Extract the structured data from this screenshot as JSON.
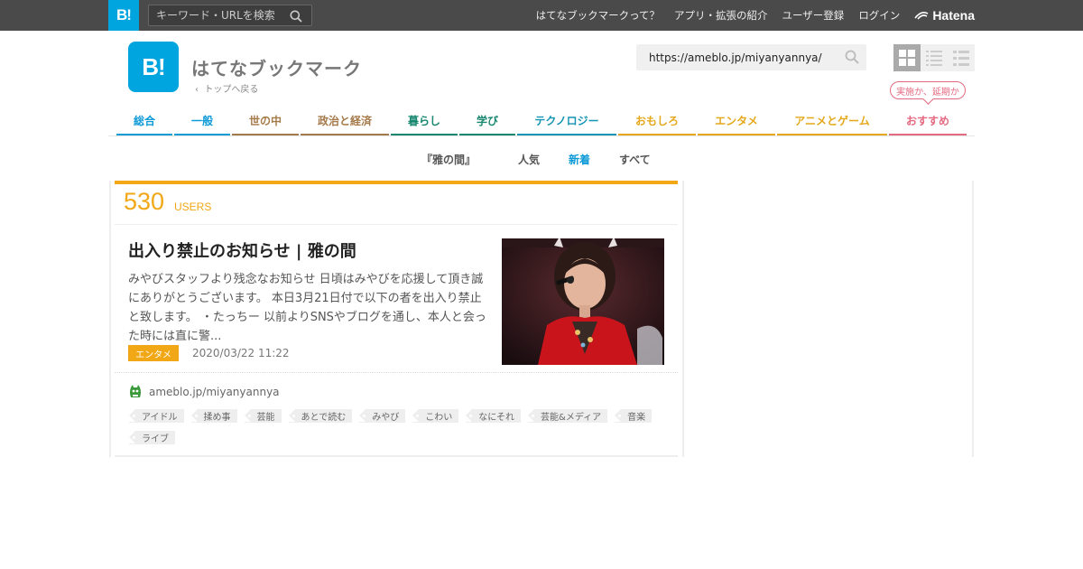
{
  "globalbar": {
    "logo": "B!",
    "search_placeholder": "キーワード・URLを検索",
    "links": [
      "はてなブックマークって？",
      "アプリ・拡張の紹介",
      "ユーザー登録",
      "ログイン"
    ],
    "hatena": "Hatena"
  },
  "header": {
    "logo": "B!",
    "brand": "はてなブックマーク",
    "back": "トップへ戻る",
    "url_value": "https://ameblo.jp/miyanyannya/",
    "balloon": "実施か、延期か"
  },
  "categories": [
    {
      "label": "総合",
      "color": "#0e9ad6"
    },
    {
      "label": "一般",
      "color": "#0e9ad6"
    },
    {
      "label": "世の中",
      "color": "#a57a4a"
    },
    {
      "label": "政治と経済",
      "color": "#a57a4a"
    },
    {
      "label": "暮らし",
      "color": "#17876f"
    },
    {
      "label": "学び",
      "color": "#17876f"
    },
    {
      "label": "テクノロジー",
      "color": "#1795b5"
    },
    {
      "label": "おもしろ",
      "color": "#e5a81c"
    },
    {
      "label": "エンタメ",
      "color": "#e5a81c"
    },
    {
      "label": "アニメとゲーム",
      "color": "#e5a81c"
    },
    {
      "label": "おすすめ",
      "color": "#e46a82"
    }
  ],
  "subnav": {
    "site": "『雅の間』",
    "popular": "人気",
    "new": "新着",
    "all": "すべて",
    "active_color": "#0e9ad6"
  },
  "entry": {
    "users_count": "530",
    "users_label": "USERS",
    "title": "出入り禁止のお知らせ | 雅の間",
    "description": "みやびスタッフより残念なお知らせ 日頃はみやびを応援して頂き誠にありがとうございます。 本日3月21日付で以下の者を出入り禁止と致します。 ・たっちー 以前よりSNSやブログを通し、本人と会った時には直に警...",
    "category": "エンタメ",
    "date": "2020/03/22 11:22",
    "domain": "ameblo.jp/miyanyannya",
    "tags": [
      "アイドル",
      "揉め事",
      "芸能",
      "あとで読む",
      "みやび",
      "こわい",
      "なにそれ",
      "芸能&メディア",
      "音楽",
      "ライブ"
    ]
  }
}
